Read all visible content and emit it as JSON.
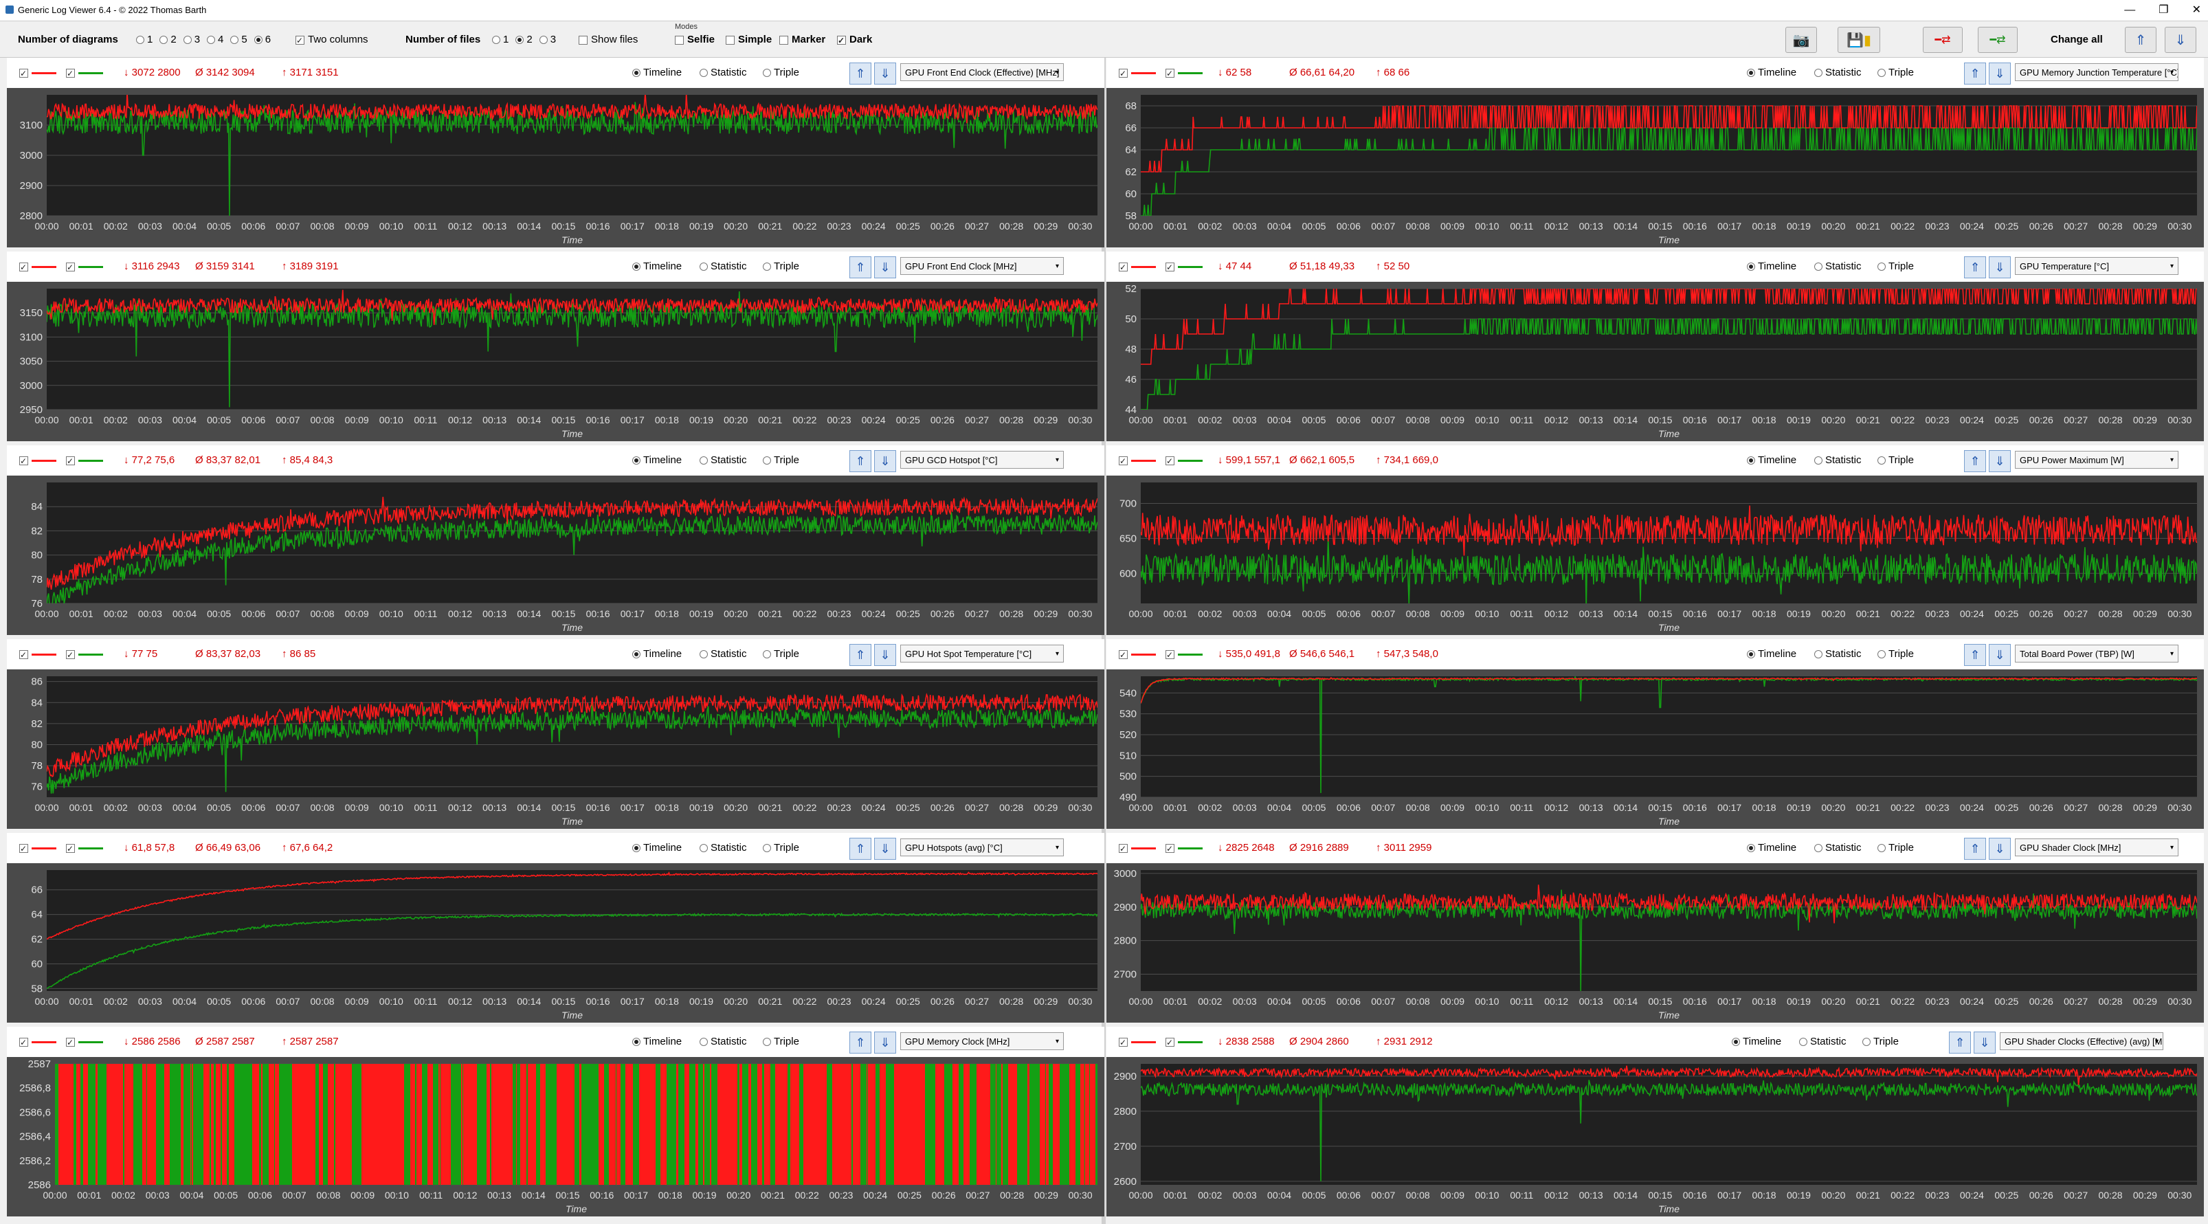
{
  "window": {
    "title": "Generic Log Viewer 6.4 - © 2022 Thomas Barth",
    "minimize": "—",
    "restore": "❐",
    "close": "✕"
  },
  "toolbar": {
    "num_diagrams_label": "Number of diagrams",
    "num_diagrams_options": [
      "1",
      "2",
      "3",
      "4",
      "5",
      "6"
    ],
    "num_diagrams_selected": "6",
    "two_columns_label": "Two columns",
    "num_files_label": "Number of files",
    "num_files_options": [
      "1",
      "2",
      "3"
    ],
    "num_files_selected": "2",
    "show_files_label": "Show files",
    "modes_label": "Modes",
    "mode_selfie": "Selfie",
    "mode_simple": "Simple",
    "mode_marker": "Marker",
    "mode_dark": "Dark",
    "change_all_label": "Change all"
  },
  "common": {
    "timeline": "Timeline",
    "statistic": "Statistic",
    "triple": "Triple",
    "xlabel": "Time",
    "red_color": "#ff1a1a",
    "green_color": "#14a014"
  },
  "chart_data": [
    {
      "type": "line",
      "sensor": "GPU Front End Clock (Effective) [MHz]",
      "min": "↓ 3072 2800",
      "avg": "Ø 3142 3094",
      "max": "↑ 3171 3151",
      "ylim": [
        2800,
        3200
      ],
      "yticks": [
        "3100",
        "3000",
        "2900",
        "2800"
      ],
      "ytickvals": [
        3100,
        3000,
        2900,
        2800
      ],
      "xlabel": "Time",
      "series": [
        {
          "mean": 3145,
          "noise": 25,
          "start": 3140,
          "tau": 0.1,
          "drops": []
        },
        {
          "mean": 3110,
          "noise": 40,
          "start": 3105,
          "tau": 0.1,
          "drops": [
            [
              5.3,
              2800
            ],
            [
              2.8,
              3000
            ],
            [
              10,
              3040
            ]
          ]
        }
      ]
    },
    {
      "type": "line",
      "sensor": "GPU Memory Junction Temperature [°C]",
      "min": "↓ 62 58",
      "avg": "Ø 66,61 64,20",
      "max": "↑ 68 66",
      "ylim": [
        58,
        69
      ],
      "yticks": [
        "68",
        "66",
        "64",
        "62",
        "60",
        "58"
      ],
      "ytickvals": [
        68,
        66,
        64,
        62,
        60,
        58
      ],
      "xlabel": "Time",
      "series": [
        {
          "mode": "step",
          "levels": [
            [
              0,
              62
            ],
            [
              0.6,
              64
            ],
            [
              1.5,
              66
            ],
            [
              7,
              66.8
            ]
          ],
          "jitter": [
            66,
            68
          ]
        },
        {
          "mode": "step",
          "levels": [
            [
              0,
              58
            ],
            [
              0.3,
              60
            ],
            [
              1,
              62
            ],
            [
              2,
              64
            ],
            [
              10,
              64.8
            ]
          ],
          "jitter": [
            64,
            66
          ]
        }
      ]
    },
    {
      "type": "line",
      "sensor": "GPU Front End Clock [MHz]",
      "min": "↓ 3116 2943",
      "avg": "Ø 3159 3141",
      "max": "↑ 3189 3191",
      "ylim": [
        2950,
        3200
      ],
      "yticks": [
        "3150",
        "3100",
        "3050",
        "3000",
        "2950"
      ],
      "ytickvals": [
        3150,
        3100,
        3050,
        3000,
        2950
      ],
      "xlabel": "Time",
      "series": [
        {
          "mean": 3165,
          "noise": 15,
          "start": 3160,
          "tau": 0.1,
          "drops": []
        },
        {
          "mean": 3145,
          "noise": 25,
          "start": 3140,
          "tau": 0.1,
          "drops": [
            [
              5.3,
              2955
            ],
            [
              2.6,
              3060
            ],
            [
              12.8,
              3070
            ],
            [
              15.4,
              3080
            ],
            [
              22.9,
              3070
            ]
          ]
        }
      ]
    },
    {
      "type": "line",
      "sensor": "GPU Temperature [°C]",
      "min": "↓ 47 44",
      "avg": "Ø 51,18 49,33",
      "max": "↑ 52 50",
      "ylim": [
        44,
        52
      ],
      "yticks": [
        "52",
        "50",
        "48",
        "46",
        "44"
      ],
      "ytickvals": [
        52,
        50,
        48,
        46,
        44
      ],
      "xlabel": "Time",
      "series": [
        {
          "mode": "step",
          "levels": [
            [
              0,
              47
            ],
            [
              0.3,
              48
            ],
            [
              1.2,
              49
            ],
            [
              2.4,
              50
            ],
            [
              4,
              51
            ],
            [
              9.5,
              51.6
            ]
          ],
          "jitter": [
            51,
            52
          ]
        },
        {
          "mode": "step",
          "levels": [
            [
              0,
              44
            ],
            [
              0.2,
              45
            ],
            [
              1,
              46
            ],
            [
              2,
              47
            ],
            [
              3.2,
              48
            ],
            [
              5.5,
              49
            ],
            [
              9.5,
              49.5
            ]
          ],
          "jitter": [
            49,
            50
          ]
        }
      ]
    },
    {
      "type": "line",
      "sensor": "GPU GCD Hotspot [°C]",
      "min": "↓ 77,2 75,6",
      "avg": "Ø 83,37 82,01",
      "max": "↑ 85,4 84,3",
      "ylim": [
        76,
        86
      ],
      "yticks": [
        "84",
        "82",
        "80",
        "78",
        "76"
      ],
      "ytickvals": [
        84,
        82,
        80,
        78,
        76
      ],
      "xlabel": "Time",
      "series": [
        {
          "mean": 84,
          "noise": 0.7,
          "start": 77.5,
          "tau": 4.5,
          "drops": []
        },
        {
          "mean": 82.5,
          "noise": 0.8,
          "start": 76,
          "tau": 4.5,
          "drops": [
            [
              5.2,
              77.5
            ],
            [
              15.3,
              80
            ]
          ]
        }
      ]
    },
    {
      "type": "line",
      "sensor": "GPU Power Maximum [W]",
      "min": "↓ 599,1 557,1",
      "avg": "Ø 662,1 605,5",
      "max": "↑ 734,1 669,0",
      "ylim": [
        557,
        730
      ],
      "yticks": [
        "700",
        "650",
        "600"
      ],
      "ytickvals": [
        700,
        650,
        600
      ],
      "xlabel": "Time",
      "series": [
        {
          "mean": 662,
          "noise": 22,
          "start": 662,
          "tau": 0.1,
          "drops": []
        },
        {
          "mean": 606,
          "noise": 22,
          "start": 606,
          "tau": 0.1,
          "drops": []
        }
      ]
    },
    {
      "type": "line",
      "sensor": "GPU Hot Spot Temperature [°C]",
      "min": "↓ 77 75",
      "avg": "Ø 83,37 82,03",
      "max": "↑ 86 85",
      "ylim": [
        75,
        86.5
      ],
      "yticks": [
        "86",
        "84",
        "82",
        "80",
        "78",
        "76"
      ],
      "ytickvals": [
        86,
        84,
        82,
        80,
        78,
        76
      ],
      "xlabel": "Time",
      "series": [
        {
          "mean": 84,
          "noise": 0.8,
          "start": 77.5,
          "tau": 4.5,
          "drops": []
        },
        {
          "mean": 82.5,
          "noise": 0.9,
          "start": 76,
          "tau": 4.5,
          "drops": [
            [
              5.2,
              75.5
            ],
            [
              12.5,
              80
            ]
          ]
        }
      ]
    },
    {
      "type": "line",
      "sensor": "Total Board Power (TBP) [W]",
      "min": "↓ 535,0 491,8",
      "avg": "Ø 546,6 546,1",
      "max": "↑ 547,3 548,0",
      "ylim": [
        490,
        548
      ],
      "yticks": [
        "540",
        "530",
        "520",
        "510",
        "500",
        "490"
      ],
      "ytickvals": [
        540,
        530,
        520,
        510,
        500,
        490
      ],
      "xlabel": "Time",
      "series": [
        {
          "mean": 546.8,
          "noise": 0.3,
          "start": 535,
          "tau": 0.2,
          "drops": []
        },
        {
          "mean": 546.5,
          "noise": 0.5,
          "start": 535,
          "tau": 0.2,
          "drops": [
            [
              5.2,
              492
            ],
            [
              12.7,
              536
            ],
            [
              15,
              533
            ],
            [
              4,
              543
            ],
            [
              8.5,
              543
            ],
            [
              18,
              543
            ]
          ]
        }
      ]
    },
    {
      "type": "line",
      "sensor": "GPU Hotspots (avg) [°C]",
      "min": "↓ 61,8 57,8",
      "avg": "Ø 66,49 63,06",
      "max": "↑ 67,6 64,2",
      "ylim": [
        57.8,
        67.6
      ],
      "yticks": [
        "66",
        "64",
        "62",
        "60",
        "58"
      ],
      "ytickvals": [
        66,
        64,
        62,
        60,
        58
      ],
      "xlabel": "Time",
      "series": [
        {
          "mean": 67.3,
          "noise": 0.06,
          "start": 62,
          "tau": 4,
          "drops": []
        },
        {
          "mean": 64,
          "noise": 0.08,
          "start": 58,
          "tau": 3.5,
          "drops": []
        }
      ]
    },
    {
      "type": "line",
      "sensor": "GPU Shader Clock [MHz]",
      "min": "↓ 2825 2648",
      "avg": "Ø 2916 2889",
      "max": "↑ 3011 2959",
      "ylim": [
        2650,
        3010
      ],
      "yticks": [
        "3000",
        "2900",
        "2800",
        "2700"
      ],
      "ytickvals": [
        3000,
        2900,
        2800,
        2700
      ],
      "xlabel": "Time",
      "series": [
        {
          "mean": 2915,
          "noise": 25,
          "start": 2915,
          "tau": 0.1,
          "drops": []
        },
        {
          "mean": 2890,
          "noise": 25,
          "start": 2890,
          "tau": 0.1,
          "drops": [
            [
              12.7,
              2650
            ],
            [
              2.7,
              2820
            ],
            [
              19,
              2830
            ]
          ]
        }
      ]
    },
    {
      "type": "bars",
      "sensor": "GPU Memory Clock [MHz]",
      "min": "↓ 2586 2586",
      "avg": "Ø 2587 2587",
      "max": "↑ 2587 2587",
      "ylim": [
        2586,
        2587
      ],
      "yticks": [
        "2587",
        "2586,8",
        "2586,6",
        "2586,4",
        "2586,2",
        "2586"
      ],
      "ytickvals": [
        2587,
        2586.8,
        2586.6,
        2586.4,
        2586.2,
        2586
      ],
      "xlabel": "Time"
    },
    {
      "type": "line",
      "sensor": "GPU Shader Clocks (Effective) (avg) [MHz]",
      "min": "↓ 2838 2588",
      "avg": "Ø 2904 2860",
      "max": "↑ 2931 2912",
      "ylim": [
        2590,
        2935
      ],
      "yticks": [
        "2900",
        "2800",
        "2700",
        "2600"
      ],
      "ytickvals": [
        2900,
        2800,
        2700,
        2600
      ],
      "xlabel": "Time",
      "series": [
        {
          "mean": 2910,
          "noise": 12,
          "start": 2910,
          "tau": 0.1,
          "drops": []
        },
        {
          "mean": 2862,
          "noise": 18,
          "start": 2862,
          "tau": 0.1,
          "drops": [
            [
              5.2,
              2600
            ],
            [
              12.7,
              2765
            ],
            [
              2.8,
              2820
            ]
          ]
        }
      ]
    }
  ],
  "xticks": [
    "00:00",
    "00:01",
    "00:02",
    "00:03",
    "00:04",
    "00:05",
    "00:06",
    "00:07",
    "00:08",
    "00:09",
    "00:10",
    "00:11",
    "00:12",
    "00:13",
    "00:14",
    "00:15",
    "00:16",
    "00:17",
    "00:18",
    "00:19",
    "00:20",
    "00:21",
    "00:22",
    "00:23",
    "00:24",
    "00:25",
    "00:26",
    "00:27",
    "00:28",
    "00:29",
    "00:30"
  ]
}
